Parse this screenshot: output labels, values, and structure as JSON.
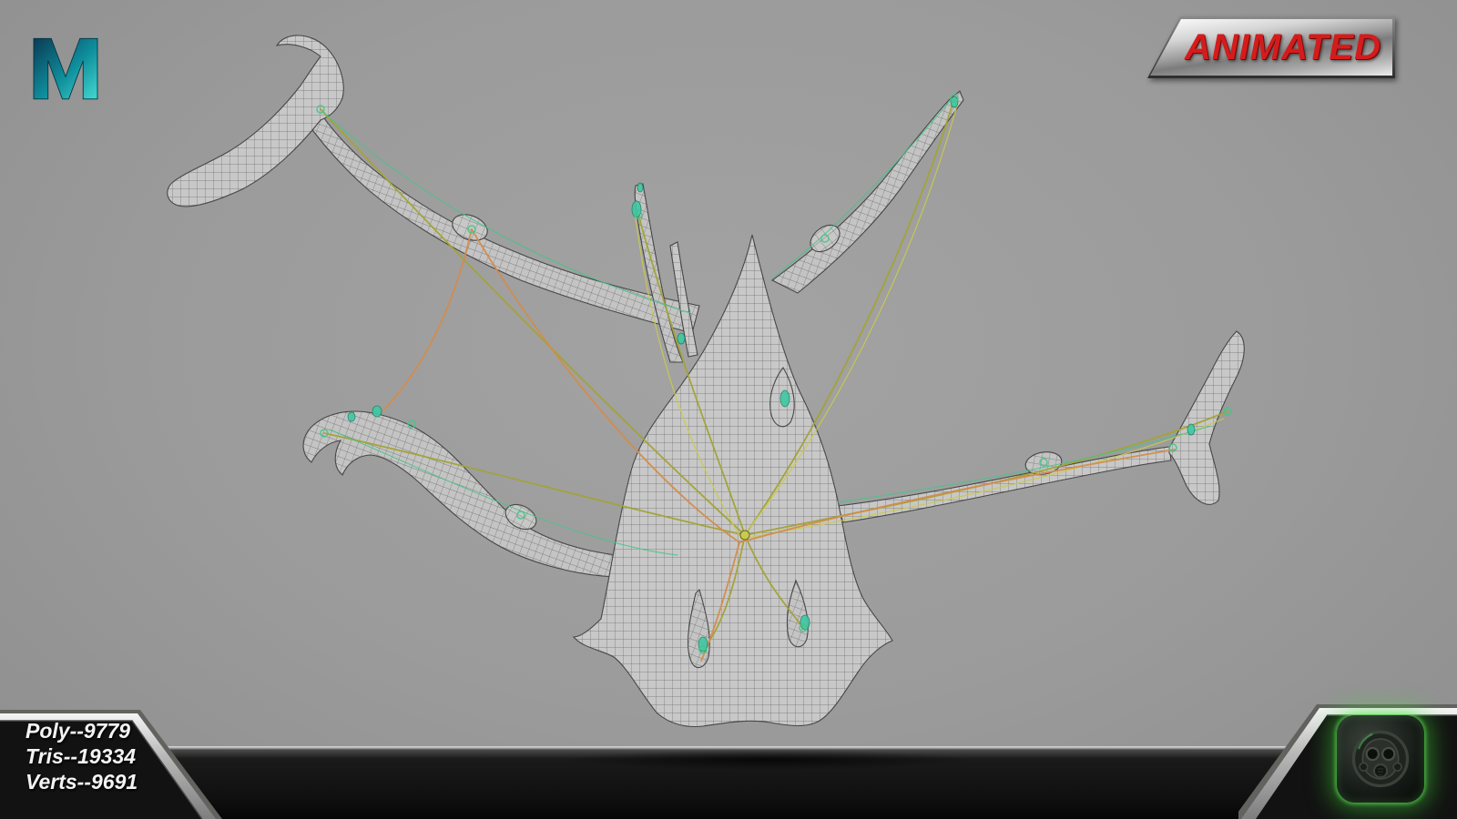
{
  "header": {
    "app_icon": "maya-logo",
    "badge": {
      "label": "ANIMATED"
    }
  },
  "stats": {
    "lines": [
      "Poly--9779",
      "Tris--19334",
      "Verts--9691"
    ]
  },
  "footer": {
    "brand_icon": "gasmask-logo"
  },
  "colors": {
    "bg": "#9b9b9b",
    "badge_text": "#d41c1c",
    "glow": "#46e03c",
    "rig_olive": "#a3a336",
    "rig_yellow": "#cbca4b",
    "rig_orange": "#d28c4c",
    "rig_green": "#46c489",
    "handle_teal": "#3ec9a4"
  }
}
